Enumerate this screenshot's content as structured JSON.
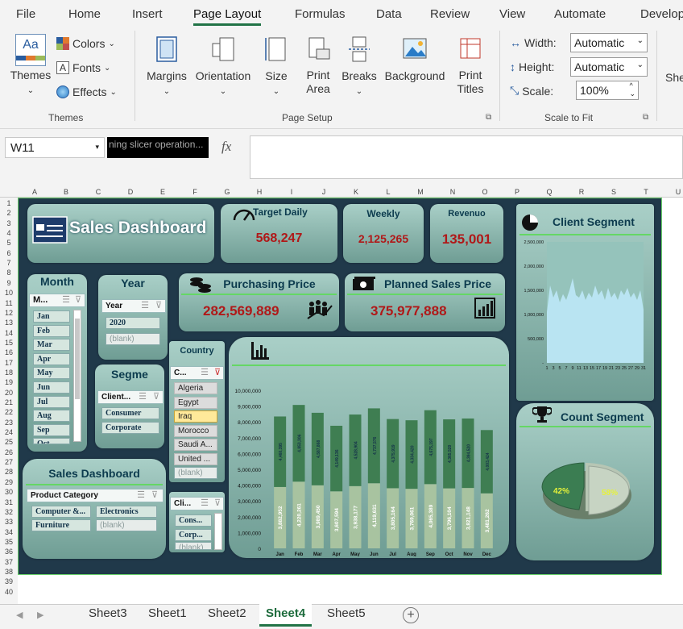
{
  "ribbon_tabs": [
    "File",
    "Home",
    "Insert",
    "Page Layout",
    "Formulas",
    "Data",
    "Review",
    "View",
    "Automate",
    "Develop"
  ],
  "themes": {
    "themes": "Themes",
    "colors": "Colors",
    "fonts": "Fonts",
    "effects": "Effects",
    "group": "Themes"
  },
  "page_setup": {
    "margins": "Margins",
    "orientation": "Orientation",
    "size": "Size",
    "print_area": "Print Area",
    "breaks": "Breaks",
    "background": "Background",
    "print_titles": "Print Titles",
    "group": "Page Setup"
  },
  "scale": {
    "width_label": "Width:",
    "width_value": "Automatic",
    "height_label": "Height:",
    "height_value": "Automatic",
    "scale_label": "Scale:",
    "scale_value": "100%",
    "group": "Scale to Fit",
    "sheet_cut": "She"
  },
  "formula_bar": {
    "name_box": "W11",
    "tooltip": "ning slicer operation...",
    "fx": "fx"
  },
  "columns": [
    "A",
    "B",
    "C",
    "D",
    "E",
    "F",
    "G",
    "H",
    "I",
    "J",
    "K",
    "L",
    "M",
    "N",
    "O",
    "P",
    "Q",
    "R",
    "S",
    "T",
    "U"
  ],
  "dashboard": {
    "title": "Sales Dashboard",
    "target_daily": {
      "label": "Target Daily",
      "value": "568,247"
    },
    "weekly": {
      "label": "Weekly",
      "value": "2,125,265"
    },
    "revenue": {
      "label": "Revenuo",
      "value": "135,001"
    },
    "purchasing": {
      "label": "Purchasing Price",
      "value": "282,569,889"
    },
    "planned": {
      "label": "Planned Sales Price",
      "value": "375,977,888"
    },
    "client_segment_title": "Client Segment",
    "count_segment_title": "Count Segment",
    "sales_dashboard_2": "Sales Dashboard"
  },
  "month_slicer": {
    "title": "Month",
    "header": "M...",
    "items": [
      "Jan",
      "Feb",
      "Mar",
      "Apr",
      "May",
      "Jun",
      "Jul",
      "Aug",
      "Sep",
      "Oct"
    ]
  },
  "year_slicer": {
    "title": "Year",
    "header": "Year",
    "items": [
      "2020",
      "(blank)"
    ]
  },
  "segment_slicer": {
    "title": "Segme",
    "header": "Client...",
    "items": [
      "Consumer",
      "Corporate"
    ]
  },
  "country_slicer": {
    "title": "Country",
    "header": "C...",
    "items": [
      "Algeria",
      "Egypt",
      "Iraq",
      "Morocco",
      "Saudi A...",
      "United ...",
      "(blank)"
    ]
  },
  "client_slicer": {
    "header": "Cli...",
    "items": [
      "Cons...",
      "Corp...",
      "(blank)"
    ]
  },
  "product_slicer": {
    "header": "Product Category",
    "items": [
      "Computer &...",
      "Electronics",
      "Furniture",
      "(blank)"
    ]
  },
  "pie": {
    "left_label": "42%",
    "right_label": "58%",
    "colors": [
      "#3b7d52",
      "#b7c6b4"
    ]
  },
  "chart_data": [
    {
      "type": "bar",
      "categories": [
        "Jan",
        "Feb",
        "Mar",
        "Apr",
        "May",
        "Jun",
        "Jul",
        "Aug",
        "Sep",
        "Oct",
        "Nov",
        "Dec"
      ],
      "series": [
        {
          "values": [
            3882952,
            4220261,
            3989450,
            3607594,
            3938177,
            4119631,
            3805164,
            3769061,
            4065389,
            3796104,
            3821148,
            3481262
          ]
        },
        {
          "values": [
            4460395,
            4853306,
            4587868,
            4149136,
            4528904,
            4737576,
            4375919,
            4334420,
            4675197,
            4365520,
            4394520,
            4003424
          ]
        }
      ],
      "yticks": [
        "0",
        "1,000,000",
        "2,000,000",
        "3,000,000",
        "4,000,000",
        "5,000,000",
        "6,000,000",
        "7,000,000",
        "8,000,000",
        "9,000,000",
        "10,000,000"
      ],
      "ylim": [
        0,
        10000000
      ],
      "colors": [
        "#a8c3a0",
        "#3f7e52"
      ]
    },
    {
      "type": "area",
      "x": [
        "1",
        "3",
        "5",
        "7",
        "9",
        "11",
        "13",
        "15",
        "17",
        "19",
        "21",
        "23",
        "25",
        "27",
        "29",
        "31"
      ],
      "yticks": [
        "-",
        "500,000",
        "1,000,000",
        "1,500,000",
        "2,000,000",
        "2,500,000"
      ],
      "ylim": [
        0,
        2500000
      ],
      "values": [
        1050000,
        1600000,
        1350000,
        1500000,
        1250000,
        1420000,
        1300000,
        1500000,
        1750000,
        1400000,
        1350000,
        1500000,
        1300000,
        1450000,
        1350000,
        1600000,
        1400000,
        1500000,
        1300000,
        1550000,
        1350000,
        1450000,
        1300000,
        1500000,
        1400000,
        1550000,
        1350000,
        1450000,
        1300000,
        1500000,
        1100000
      ],
      "color": "#b9e4f2"
    }
  ],
  "sheets": [
    "Sheet3",
    "Sheet1",
    "Sheet2",
    "Sheet4",
    "Sheet5"
  ],
  "active_sheet": "Sheet4"
}
